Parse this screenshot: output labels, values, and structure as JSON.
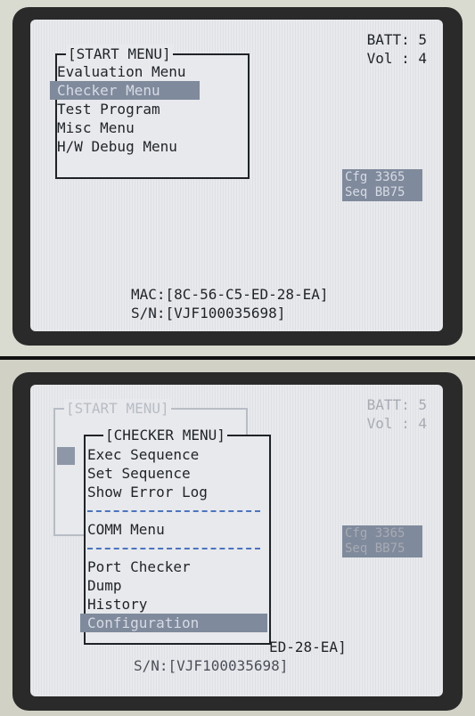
{
  "top": {
    "batt": "BATT: 5",
    "vol": "Vol : 4",
    "start_menu": {
      "title": "[START MENU]",
      "items": [
        "Evaluation Menu",
        "Checker Menu",
        "Test Program",
        "Misc Menu",
        "H/W Debug Menu"
      ],
      "selected": 1
    },
    "cfg": "Cfg 3365",
    "seq": "Seq BB75",
    "mac": "MAC:[8C-56-C5-ED-28-EA]",
    "sn": "S/N:[VJF100035698]"
  },
  "bottom": {
    "batt": "BATT: 5",
    "vol": "Vol : 4",
    "start_menu_title": "[START MENU]",
    "checker_menu": {
      "title": "[CHECKER MENU]",
      "items": [
        "Exec Sequence",
        "Set Sequence",
        "Show Error Log",
        "COMM Menu",
        "Port Checker",
        "Dump",
        "History",
        "Configuration"
      ],
      "selected": 7
    },
    "cfg": "Cfg 3365",
    "seq": "Seq BB75",
    "mac_partial": "ED-28-EA]",
    "sn": "S/N:[VJF100035698]"
  }
}
